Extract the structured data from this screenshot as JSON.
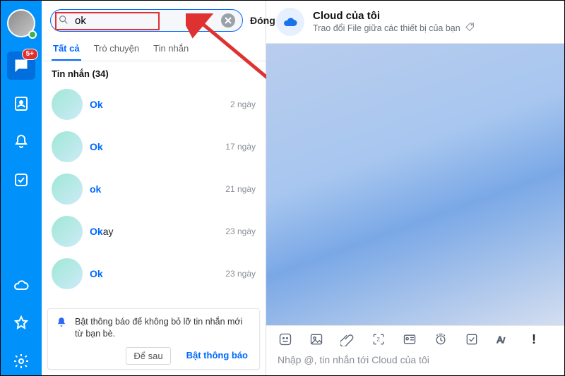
{
  "colors": {
    "accent": "#0068ff",
    "rail": "#0191fa",
    "badge": "#e03131"
  },
  "rail": {
    "badge_text": "5+",
    "icons": [
      "chat",
      "contacts",
      "bell",
      "todo",
      "cloud",
      "star",
      "settings"
    ]
  },
  "search": {
    "value": "ok",
    "placeholder": "",
    "close_label": "Đóng"
  },
  "tabs": [
    {
      "label": "Tất cả",
      "active": true
    },
    {
      "label": "Trò chuyện",
      "active": false
    },
    {
      "label": "Tin nhắn",
      "active": false
    }
  ],
  "section_title": "Tin nhắn (34)",
  "results": [
    {
      "prefix": "",
      "hl": "Ok",
      "suffix": "",
      "time": "2 ngày"
    },
    {
      "prefix": "",
      "hl": "Ok",
      "suffix": "",
      "time": "17 ngày"
    },
    {
      "prefix": "",
      "hl": "ok",
      "suffix": "",
      "time": "21 ngày"
    },
    {
      "prefix": "",
      "hl": "Ok",
      "suffix": "ay",
      "time": "23 ngày"
    },
    {
      "prefix": "",
      "hl": "Ok",
      "suffix": "",
      "time": "23 ngày"
    }
  ],
  "notification": {
    "text": "Bật thông báo để không bỏ lỡ tin nhắn mới từ bạn bè.",
    "later": "Để sau",
    "enable": "Bật thông báo"
  },
  "chat": {
    "title": "Cloud của tôi",
    "subtitle": "Trao đổi File giữa các thiết bị của bạn",
    "composer_placeholder": "Nhập @, tin nhắn tới Cloud của tôi",
    "composer_icons": [
      "sticker",
      "image",
      "attachment",
      "screenshot",
      "card",
      "reminder",
      "task",
      "format",
      "priority"
    ]
  }
}
